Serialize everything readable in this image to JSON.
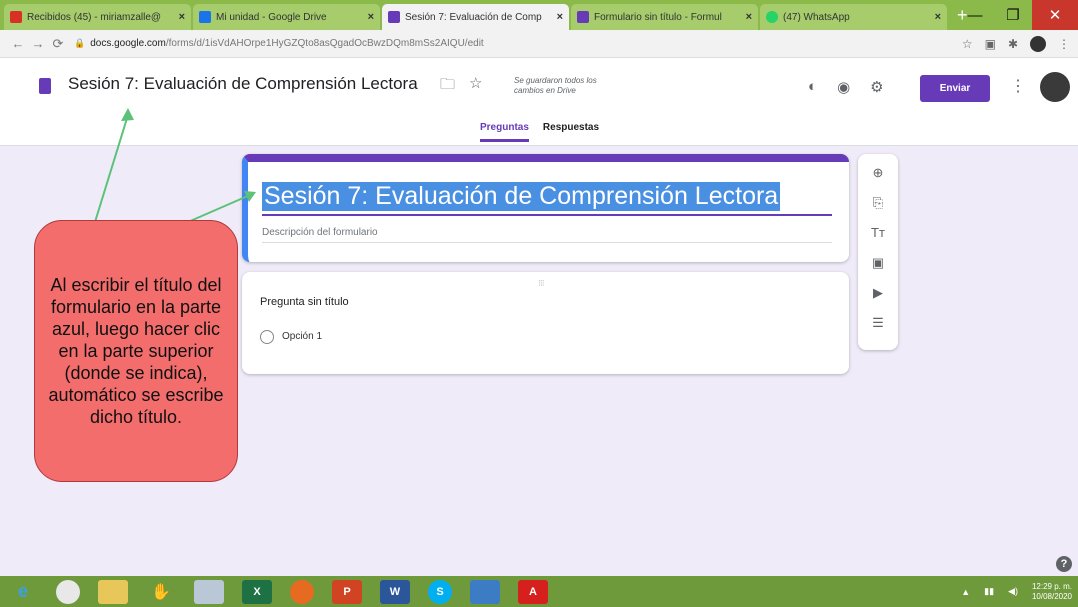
{
  "browser": {
    "tabs": [
      {
        "title": "Recibidos (45) - miriamzalle@",
        "icon": "gmail-icon",
        "color": "#d93025",
        "active": false
      },
      {
        "title": "Mi unidad - Google Drive",
        "icon": "drive-icon",
        "color": "#1a73e8",
        "active": false
      },
      {
        "title": "Sesión 7: Evaluación de Comp",
        "icon": "forms-icon",
        "color": "#673ab7",
        "active": true
      },
      {
        "title": "Formulario sin título - Formul",
        "icon": "forms-icon",
        "color": "#673ab7",
        "active": false
      },
      {
        "title": "(47) WhatsApp",
        "icon": "whatsapp-icon",
        "color": "#25d366",
        "active": false
      }
    ],
    "url_domain": "docs.google.com",
    "url_path": "/forms/d/1isVdAHOrpe1HyGZQto8asQgadOcBwzDQm8mSs2AIQU/edit"
  },
  "forms_header": {
    "title": "Sesión 7: Evaluación de Comprensión Lectora",
    "saved_status": "Se guardaron todos los cambios en Drive",
    "send_label": "Enviar",
    "tabs": [
      "Preguntas",
      "Respuestas"
    ]
  },
  "form": {
    "title": "Sesión 7: Evaluación de Comprensión Lectora",
    "description_placeholder": "Descripción del formulario",
    "question_title": "Pregunta sin título",
    "option_label": "Opción 1"
  },
  "toolbar": [
    "add-question-icon",
    "import-questions-icon",
    "add-title-icon",
    "add-image-icon",
    "add-video-icon",
    "add-section-icon"
  ],
  "annotation": {
    "text": "Al escribir el título del formulario en la parte azul, luego hacer clic en la parte superior (donde se indica), automático se escribe dicho título."
  },
  "taskbar": {
    "time": "12:29 p. m.",
    "date": "10/08/2020"
  }
}
